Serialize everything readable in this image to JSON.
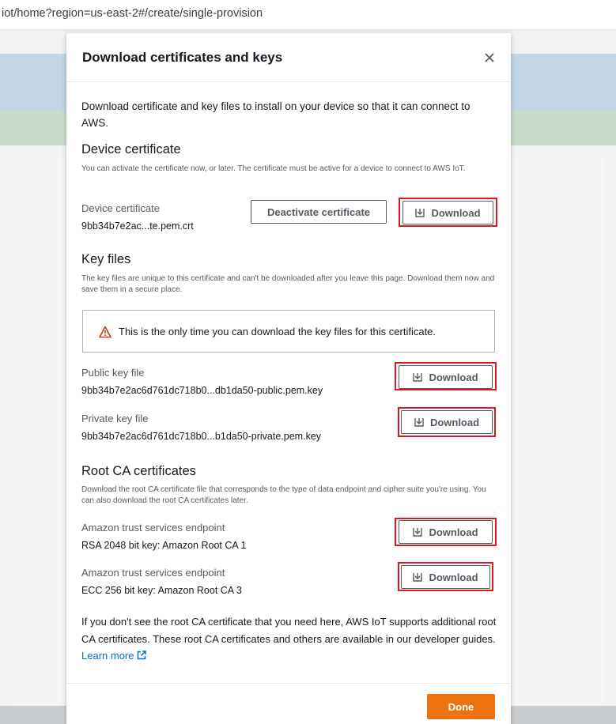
{
  "browser": {
    "url": "iot/home?region=us-east-2#/create/single-provision"
  },
  "modal": {
    "title": "Download certificates and keys",
    "close_icon": "close-icon",
    "intro": "Download certificate and key files to install on your device so that it can connect to AWS.",
    "device_certificate": {
      "heading": "Device certificate",
      "description": "You can activate the certificate now, or later. The certificate must be active for a device to connect to AWS IoT.",
      "label": "Device certificate",
      "file": "9bb34b7e2ac...te.pem.crt",
      "deactivate_label": "Deactivate certificate",
      "download_label": "Download"
    },
    "key_files": {
      "heading": "Key files",
      "description": "The key files are unique to this certificate and can't be downloaded after you leave this page. Download them now and save them in a secure place.",
      "alert": "This is the only time you can download the key files for this certificate.",
      "public_label": "Public key file",
      "public_file": "9bb34b7e2ac6d761dc718b0...db1da50-public.pem.key",
      "private_label": "Private key file",
      "private_file": "9bb34b7e2ac6d761dc718b0...b1da50-private.pem.key",
      "download_label": "Download"
    },
    "root_ca": {
      "heading": "Root CA certificates",
      "description": "Download the root CA certificate file that corresponds to the type of data endpoint and cipher suite you're using. You can also download the root CA certificates later.",
      "rsa_label": "Amazon trust services endpoint",
      "rsa_value": "RSA 2048 bit key: Amazon Root CA 1",
      "ecc_label": "Amazon trust services endpoint",
      "ecc_value": "ECC 256 bit key: Amazon Root CA 3",
      "download_label": "Download"
    },
    "footnote": "If you don't see the root CA certificate that you need here, AWS IoT supports additional root CA certificates. These root CA certificates and others are available in our developer guides.",
    "learn_more": "Learn more",
    "done_label": "Done"
  },
  "colors": {
    "primary_button": "#ec7211",
    "highlight": "#e0181e",
    "link": "#0073bb",
    "warning": "#d13212"
  }
}
